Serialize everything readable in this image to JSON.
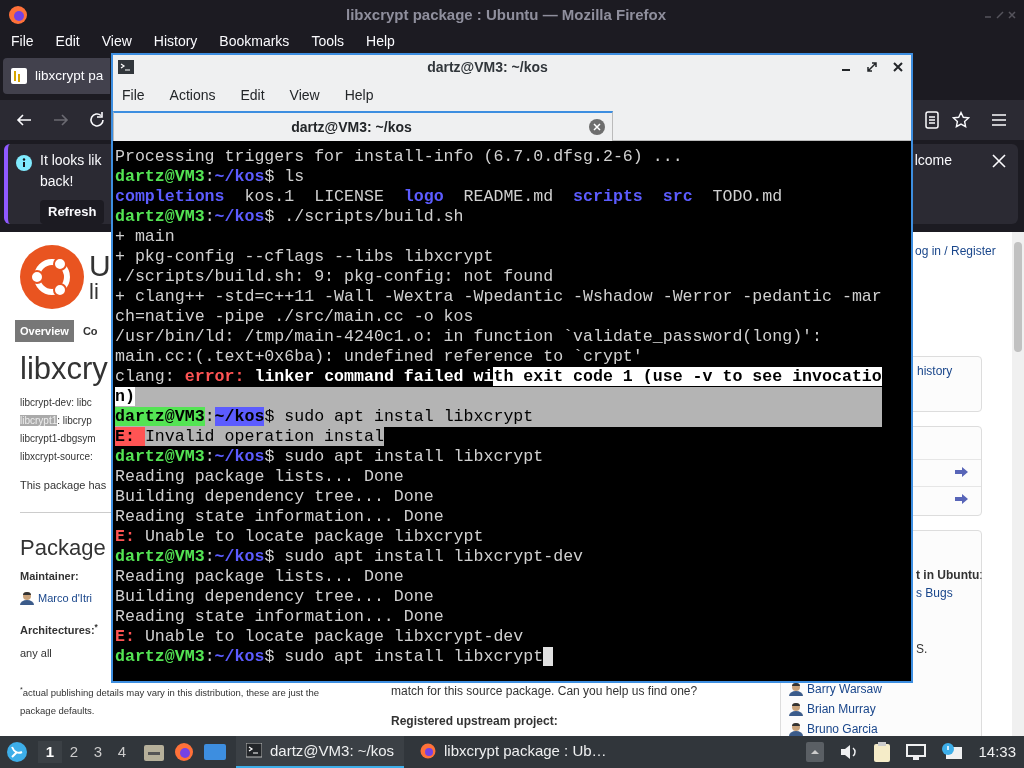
{
  "firefox": {
    "title": "libxcrypt package : Ubuntu — Mozilla Firefox",
    "menu": [
      "File",
      "Edit",
      "View",
      "History",
      "Bookmarks",
      "Tools",
      "Help"
    ],
    "tab": {
      "label": "libxcrypt pa",
      "selected": true
    },
    "notification": {
      "lines": [
        "It looks lik",
        "back!"
      ],
      "button": "Refresh",
      "right_text": "lcome"
    }
  },
  "page": {
    "header_big": "U",
    "header_sub": "li",
    "tabs": [
      {
        "label": "Overview",
        "selected": true
      },
      {
        "label": "Co",
        "selected": false
      }
    ],
    "heading": "libxcry",
    "binaries": [
      {
        "name": "libcrypt-dev",
        "rest": ": libc",
        "highlighted": false
      },
      {
        "name": "libcrypt1",
        "rest": ": libcryp",
        "highlighted": true
      },
      {
        "name": "libcrypt1-dbgsym",
        "highlighted": false
      },
      {
        "name": "libxcrypt-source",
        "rest": ":",
        "highlighted": false
      }
    ],
    "note": "This package has",
    "section": "Package",
    "maintainer_label": "Maintainer:",
    "maintainer": "Marco d'Itri",
    "arch_label": "Architectures:$^{*}$",
    "arch_value": "any all",
    "footnote": [
      "$^{*}$actual publishing details may vary in this distribution, these are just the",
      "package defaults."
    ],
    "middle_text": "match for this source package. Can you help us find one?",
    "upstream_label": "Registered upstream project:",
    "sidebar": {
      "login": "og in / Register",
      "history": "history",
      "ubuntu_label": "**t in Ubuntu**:",
      "bugs": "s Bugs",
      "s_text": "S.",
      "people": [
        "Barry Warsaw",
        "Brian Murray",
        "Bruno Garcia"
      ]
    }
  },
  "terminal": {
    "title": "dartz@VM3: ~/kos",
    "menu": [
      "File",
      "Actions",
      "Edit",
      "View",
      "Help"
    ],
    "tab": {
      "label": "dartz@VM3: ~/kos",
      "selected": true
    },
    "lines": [
      {
        "selection_to_end": false,
        "segments": [
          {
            "text": "Processing triggers for install-info (6.7.0.dfsg.2-6) ...",
            "kind": "plain",
            "selected": false
          }
        ]
      },
      {
        "selection_to_end": false,
        "segments": [
          {
            "text": "dartz@VM3",
            "kind": "user",
            "selected": false
          },
          {
            "text": ":",
            "kind": "plain",
            "selected": false
          },
          {
            "text": "~/kos",
            "kind": "path",
            "selected": false
          },
          {
            "text": "$ ls",
            "kind": "plain",
            "selected": false
          }
        ]
      },
      {
        "selection_to_end": false,
        "segments": [
          {
            "text": "completions",
            "kind": "dir",
            "selected": false
          },
          {
            "text": "  kos.1  LICENSE  ",
            "kind": "plain",
            "selected": false
          },
          {
            "text": "logo",
            "kind": "dir",
            "selected": false
          },
          {
            "text": "  README.md  ",
            "kind": "plain",
            "selected": false
          },
          {
            "text": "scripts  ",
            "kind": "dir",
            "selected": false
          },
          {
            "text": "src",
            "kind": "dir",
            "selected": false
          },
          {
            "text": "  TODO.md",
            "kind": "plain",
            "selected": false
          }
        ]
      },
      {
        "selection_to_end": false,
        "segments": [
          {
            "text": "dartz@VM3",
            "kind": "user",
            "selected": false
          },
          {
            "text": ":",
            "kind": "plain",
            "selected": false
          },
          {
            "text": "~/kos",
            "kind": "path",
            "selected": false
          },
          {
            "text": "$ ./scripts/build.sh",
            "kind": "plain",
            "selected": false
          }
        ]
      },
      {
        "selection_to_end": false,
        "segments": [
          {
            "text": "+ main",
            "kind": "plain",
            "selected": false
          }
        ]
      },
      {
        "selection_to_end": false,
        "segments": [
          {
            "text": "+ pkg-config --cflags --libs libxcrypt",
            "kind": "plain",
            "selected": false
          }
        ]
      },
      {
        "selection_to_end": false,
        "segments": [
          {
            "text": "./scripts/build.sh: 9: pkg-config: not found",
            "kind": "plain",
            "selected": false
          }
        ]
      },
      {
        "selection_to_end": false,
        "segments": [
          {
            "text": "+ clang++ -std=c++11 -Wall -Wextra -Wpedantic -Wshadow -Werror -pedantic -mar",
            "kind": "plain",
            "selected": false
          }
        ]
      },
      {
        "selection_to_end": false,
        "segments": [
          {
            "text": "ch=native -pipe ./src/main.cc -o kos",
            "kind": "plain",
            "selected": false
          }
        ]
      },
      {
        "selection_to_end": false,
        "segments": [
          {
            "text": "/usr/bin/ld: /tmp/main-4240c1.o: in function `validate_password(long)':",
            "kind": "plain",
            "selected": false
          }
        ]
      },
      {
        "selection_to_end": false,
        "segments": [
          {
            "text": "main.cc:(.text+0x6ba): undefined reference to `crypt'",
            "kind": "plain",
            "selected": false
          }
        ]
      },
      {
        "selection_to_end": false,
        "segments": [
          {
            "text": "clang: ",
            "kind": "plain",
            "selected": false
          },
          {
            "text": "error:",
            "kind": "error",
            "selected": false
          },
          {
            "text": " linker command failed wi",
            "kind": "bold",
            "selected": false
          },
          {
            "text": "th exit code 1 (use -v to see invocatio",
            "kind": "bold",
            "selected": true
          }
        ]
      },
      {
        "selection_to_end": true,
        "segments": [
          {
            "text": "n)",
            "kind": "bold",
            "selected": true
          }
        ]
      },
      {
        "selection_to_end": true,
        "segments": [
          {
            "text": "dartz@VM3",
            "kind": "user",
            "selected": true
          },
          {
            "text": ":",
            "kind": "plain",
            "selected": true
          },
          {
            "text": "~/kos",
            "kind": "path",
            "selected": true
          },
          {
            "text": "$ sudo apt instal libxcrypt",
            "kind": "plain",
            "selected": true
          }
        ]
      },
      {
        "selection_to_end": false,
        "segments": [
          {
            "text": "E: ",
            "kind": "error",
            "selected": true
          },
          {
            "text": "Invalid operation instal",
            "kind": "plain",
            "selected": true
          }
        ]
      },
      {
        "selection_to_end": false,
        "segments": [
          {
            "text": "dartz@VM3",
            "kind": "user",
            "selected": false
          },
          {
            "text": ":",
            "kind": "plain",
            "selected": false
          },
          {
            "text": "~/kos",
            "kind": "path",
            "selected": false
          },
          {
            "text": "$ sudo apt install libxcrypt",
            "kind": "plain",
            "selected": false
          }
        ]
      },
      {
        "selection_to_end": false,
        "segments": [
          {
            "text": "Reading package lists... Done",
            "kind": "plain",
            "selected": false
          }
        ]
      },
      {
        "selection_to_end": false,
        "segments": [
          {
            "text": "Building dependency tree... Done",
            "kind": "plain",
            "selected": false
          }
        ]
      },
      {
        "selection_to_end": false,
        "segments": [
          {
            "text": "Reading state information... Done",
            "kind": "plain",
            "selected": false
          }
        ]
      },
      {
        "selection_to_end": false,
        "segments": [
          {
            "text": "E:",
            "kind": "error",
            "selected": false
          },
          {
            "text": " Unable to locate package libxcrypt",
            "kind": "plain",
            "selected": false
          }
        ]
      },
      {
        "selection_to_end": false,
        "segments": [
          {
            "text": "dartz@VM3",
            "kind": "user",
            "selected": false
          },
          {
            "text": ":",
            "kind": "plain",
            "selected": false
          },
          {
            "text": "~/kos",
            "kind": "path",
            "selected": false
          },
          {
            "text": "$ sudo apt install libxcrypt-dev",
            "kind": "plain",
            "selected": false
          }
        ]
      },
      {
        "selection_to_end": false,
        "segments": [
          {
            "text": "Reading package lists... Done",
            "kind": "plain",
            "selected": false
          }
        ]
      },
      {
        "selection_to_end": false,
        "segments": [
          {
            "text": "Building dependency tree... Done",
            "kind": "plain",
            "selected": false
          }
        ]
      },
      {
        "selection_to_end": false,
        "segments": [
          {
            "text": "Reading state information... Done",
            "kind": "plain",
            "selected": false
          }
        ]
      },
      {
        "selection_to_end": false,
        "segments": [
          {
            "text": "E:",
            "kind": "error",
            "selected": false
          },
          {
            "text": " Unable to locate package libxcrypt-dev",
            "kind": "plain",
            "selected": false
          }
        ]
      },
      {
        "selection_to_end": false,
        "cursor": true,
        "segments": [
          {
            "text": "dartz@VM3",
            "kind": "user",
            "selected": false
          },
          {
            "text": ":",
            "kind": "plain",
            "selected": false
          },
          {
            "text": "~/kos",
            "kind": "path",
            "selected": false
          },
          {
            "text": "$ sudo apt install libxcrypt",
            "kind": "plain",
            "selected": false
          }
        ]
      }
    ]
  },
  "taskbar": {
    "workspaces": [
      {
        "label": "1",
        "selected": true
      },
      {
        "label": "2",
        "selected": false
      },
      {
        "label": "3",
        "selected": false
      },
      {
        "label": "4",
        "selected": false
      }
    ],
    "tasks": [
      {
        "label": "dartz@VM3: ~/kos",
        "kind": "terminal",
        "active": true
      },
      {
        "label": "libxcrypt package : Ub…",
        "kind": "browser",
        "active": false
      }
    ],
    "clock": "14:33"
  }
}
